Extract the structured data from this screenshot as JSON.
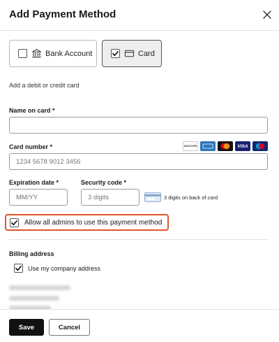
{
  "dialog": {
    "title": "Add Payment Method"
  },
  "methods": {
    "bank": {
      "label": "Bank Account",
      "checked": false
    },
    "card": {
      "label": "Card",
      "checked": true
    }
  },
  "helper_text": "Add a debit or credit card",
  "form": {
    "name_on_card": {
      "label": "Name on card *",
      "value": "",
      "placeholder": ""
    },
    "card_number": {
      "label": "Card number *",
      "placeholder": "1234 5678 9012 3456"
    },
    "expiration": {
      "label": "Expiration date *",
      "placeholder": "MM/YY"
    },
    "security": {
      "label": "Security code *",
      "placeholder": "3 digits",
      "hint": "3 digits on back of card"
    }
  },
  "card_brands": [
    {
      "name": "DISCOVER",
      "color": "#ffffff",
      "text_color": "#f58220"
    },
    {
      "name": "AMEX",
      "color": "#2e77bc",
      "text_color": "#ffffff"
    },
    {
      "name": "mastercard",
      "color": "#ffffff"
    },
    {
      "name": "VISA",
      "color": "#1a1f71",
      "text_color": "#ffffff"
    },
    {
      "name": "maestro",
      "color": "#ffffff"
    }
  ],
  "admin_option": {
    "label": "Allow all admins to use this payment method",
    "checked": true,
    "highlight_color": "#e0552c"
  },
  "billing": {
    "section_label": "Billing address",
    "use_company_label": "Use my company address",
    "use_company_checked": true
  },
  "footer": {
    "save_label": "Save",
    "cancel_label": "Cancel"
  }
}
